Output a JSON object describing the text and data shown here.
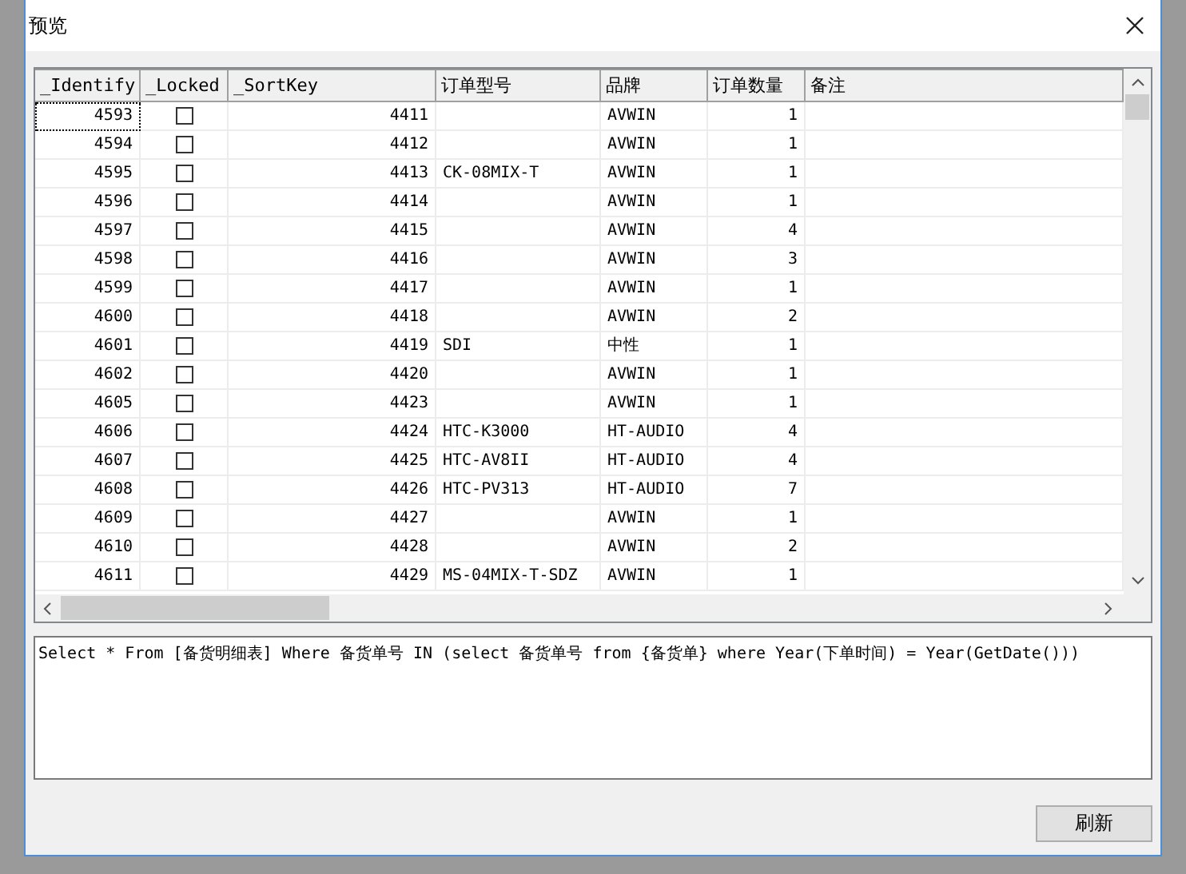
{
  "window": {
    "title": "预览"
  },
  "table": {
    "columns": [
      "_Identify",
      "_Locked",
      "_SortKey",
      "订单型号",
      "品牌",
      "订单数量",
      "备注"
    ],
    "rows": [
      {
        "identify": "4593",
        "locked": false,
        "sort_key": "4411",
        "model": "",
        "brand": "AVWIN",
        "quantity": "1",
        "focused": true
      },
      {
        "identify": "4594",
        "locked": false,
        "sort_key": "4412",
        "model": "",
        "brand": "AVWIN",
        "quantity": "1",
        "focused": false
      },
      {
        "identify": "4595",
        "locked": false,
        "sort_key": "4413",
        "model": "CK-08MIX-T",
        "brand": "AVWIN",
        "quantity": "1",
        "focused": false
      },
      {
        "identify": "4596",
        "locked": false,
        "sort_key": "4414",
        "model": "",
        "brand": "AVWIN",
        "quantity": "1",
        "focused": false
      },
      {
        "identify": "4597",
        "locked": false,
        "sort_key": "4415",
        "model": "",
        "brand": "AVWIN",
        "quantity": "4",
        "focused": false
      },
      {
        "identify": "4598",
        "locked": false,
        "sort_key": "4416",
        "model": "",
        "brand": "AVWIN",
        "quantity": "3",
        "focused": false
      },
      {
        "identify": "4599",
        "locked": false,
        "sort_key": "4417",
        "model": "",
        "brand": "AVWIN",
        "quantity": "1",
        "focused": false
      },
      {
        "identify": "4600",
        "locked": false,
        "sort_key": "4418",
        "model": "",
        "brand": "AVWIN",
        "quantity": "2",
        "focused": false
      },
      {
        "identify": "4601",
        "locked": false,
        "sort_key": "4419",
        "model": "SDI",
        "brand": "中性",
        "quantity": "1",
        "focused": false
      },
      {
        "identify": "4602",
        "locked": false,
        "sort_key": "4420",
        "model": "",
        "brand": "AVWIN",
        "quantity": "1",
        "focused": false
      },
      {
        "identify": "4605",
        "locked": false,
        "sort_key": "4423",
        "model": "",
        "brand": "AVWIN",
        "quantity": "1",
        "focused": false
      },
      {
        "identify": "4606",
        "locked": false,
        "sort_key": "4424",
        "model": "HTC-K3000",
        "brand": "HT-AUDIO",
        "quantity": "4",
        "focused": false
      },
      {
        "identify": "4607",
        "locked": false,
        "sort_key": "4425",
        "model": "HTC-AV8II",
        "brand": "HT-AUDIO",
        "quantity": "4",
        "focused": false
      },
      {
        "identify": "4608",
        "locked": false,
        "sort_key": "4426",
        "model": "HTC-PV313",
        "brand": "HT-AUDIO",
        "quantity": "7",
        "focused": false
      },
      {
        "identify": "4609",
        "locked": false,
        "sort_key": "4427",
        "model": "",
        "brand": "AVWIN",
        "quantity": "1",
        "focused": false
      },
      {
        "identify": "4610",
        "locked": false,
        "sort_key": "4428",
        "model": "",
        "brand": "AVWIN",
        "quantity": "2",
        "focused": false
      },
      {
        "identify": "4611",
        "locked": false,
        "sort_key": "4429",
        "model": "MS-04MIX-T-SDZ",
        "brand": "AVWIN",
        "quantity": "1",
        "focused": false
      }
    ]
  },
  "query": {
    "value": "Select * From [备货明细表] Where 备货单号 IN (select 备货单号 from {备货单} where Year(下单时间) = Year(GetDate()))"
  },
  "buttons": [
    "刷新"
  ]
}
